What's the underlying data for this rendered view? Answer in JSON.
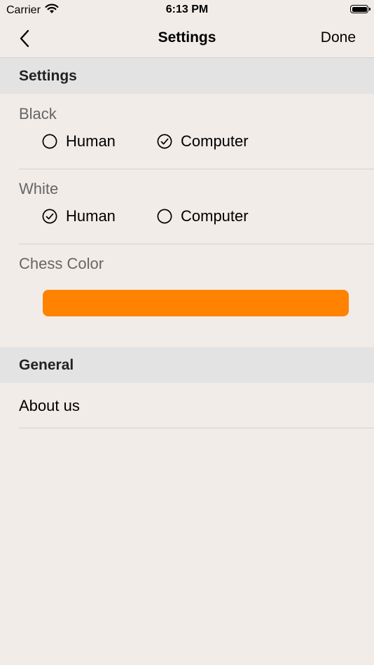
{
  "status_bar": {
    "carrier": "Carrier",
    "time": "6:13 PM",
    "wifi_icon": "wifi-icon",
    "battery_icon": "battery-icon"
  },
  "nav": {
    "back_icon": "chevron-left-icon",
    "title": "Settings",
    "done_label": "Done"
  },
  "settings_section": {
    "header": "Settings",
    "black": {
      "label": "Black",
      "options": [
        "Human",
        "Computer"
      ],
      "selected": "Computer"
    },
    "white": {
      "label": "White",
      "options": [
        "Human",
        "Computer"
      ],
      "selected": "Human"
    },
    "chess_color": {
      "label": "Chess Color",
      "value": "#ff8200"
    }
  },
  "general_section": {
    "header": "General",
    "items": [
      {
        "label": "About us"
      }
    ]
  }
}
